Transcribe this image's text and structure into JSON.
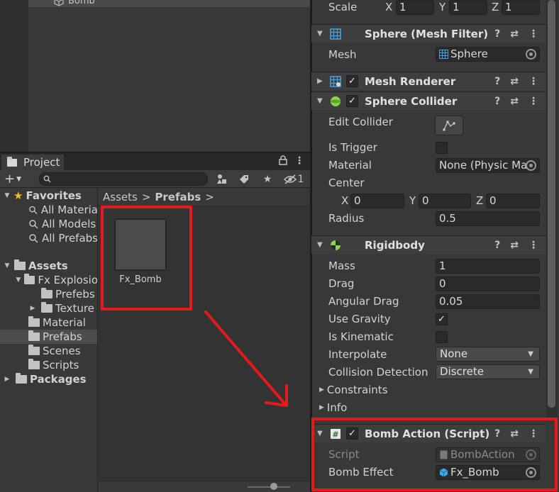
{
  "hierarchy": {
    "item_label": "Bomb"
  },
  "project": {
    "tab_label": "Project",
    "hidden_count": "1",
    "tree": {
      "favorites": "Favorites",
      "all_materials": "All Materia",
      "all_models": "All Models",
      "all_prefabs": "All Prefabs",
      "assets": "Assets",
      "fx_explosion": "Fx Explosio",
      "fx_prefebs": "Prefebs",
      "fx_textures": "Texture",
      "material": "Material",
      "prefabs": "Prefabs",
      "scenes": "Scenes",
      "scripts": "Scripts",
      "packages": "Packages"
    },
    "breadcrumb": {
      "root": "Assets",
      "sep": ">",
      "current": "Prefabs",
      "trail": ">"
    },
    "asset": {
      "name": "Fx_Bomb"
    }
  },
  "inspector": {
    "transform": {
      "scale_label": "Scale",
      "x_label": "X",
      "y_label": "Y",
      "z_label": "Z",
      "x": "1",
      "y": "1",
      "z": "1"
    },
    "mesh_filter": {
      "title": "Sphere (Mesh Filter)",
      "mesh_label": "Mesh",
      "mesh_value": "Sphere"
    },
    "mesh_renderer": {
      "title": "Mesh Renderer"
    },
    "sphere_collider": {
      "title": "Sphere Collider",
      "edit_collider_label": "Edit Collider",
      "is_trigger_label": "Is Trigger",
      "material_label": "Material",
      "material_value": "None (Physic Ma",
      "center_label": "Center",
      "x_label": "X",
      "y_label": "Y",
      "z_label": "Z",
      "center_x": "0",
      "center_y": "0",
      "center_z": "0",
      "radius_label": "Radius",
      "radius_value": "0.5"
    },
    "rigidbody": {
      "title": "Rigidbody",
      "mass_label": "Mass",
      "mass": "1",
      "drag_label": "Drag",
      "drag": "0",
      "angular_drag_label": "Angular Drag",
      "angular_drag": "0.05",
      "use_gravity_label": "Use Gravity",
      "is_kinematic_label": "Is Kinematic",
      "interpolate_label": "Interpolate",
      "interpolate": "None",
      "collision_label": "Collision Detection",
      "collision": "Discrete",
      "constraints_label": "Constraints",
      "info_label": "Info"
    },
    "bomb_action": {
      "title": "Bomb Action (Script)",
      "script_label": "Script",
      "script_value": "BombAction",
      "bomb_effect_label": "Bomb Effect",
      "bomb_effect_value": "Fx_Bomb"
    }
  },
  "colors": {
    "annotation": "#e51a1a",
    "panel": "#383838",
    "field": "#2a2a2a"
  }
}
